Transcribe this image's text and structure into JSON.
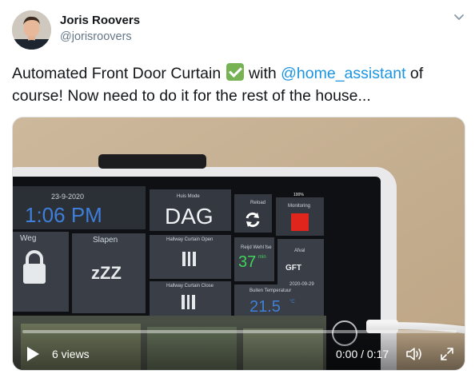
{
  "author": {
    "display_name": "Joris Roovers",
    "username": "@jorisroovers",
    "avatar_icon": "person-avatar"
  },
  "tweet": {
    "text_part1": "Automated Front Door Curtain ",
    "emoji": "white-check-mark-icon",
    "text_part2": " with ",
    "mention": "@home_assistant",
    "text_part3": " of course! Now need to do it for the rest of the house..."
  },
  "video": {
    "views": "6 views",
    "time": "0:00 / 0:17",
    "progress": 0
  },
  "dashboard": {
    "date": "23-9-2020",
    "time": "1:06 PM",
    "weg": "Weg",
    "slapen": "Slapen",
    "zzz": "zZZ",
    "huis_mode": "Huis Mode",
    "dag": "DAG",
    "reload": "Reload",
    "monitoring": "Monitoring",
    "hallway_open": "Hallway Curtain Open",
    "temp_label": "Reijd Wehl fse",
    "temp_value": "37",
    "temp_unit": "min",
    "afval": "Afval",
    "gft": "GFT",
    "afval_date": "2020-09-29",
    "hallway_close": "Hallway Curtain Close",
    "buiten_label": "Buiten Temperatuur",
    "buiten_value": "21.5",
    "buiten_unit": "°C",
    "status": "100%"
  },
  "colors": {
    "mention": "#1b95e0",
    "handle": "#657786",
    "time_blue": "#3f7fd9",
    "temp_green": "#3fd35c",
    "monitor_red": "#e0261c"
  }
}
